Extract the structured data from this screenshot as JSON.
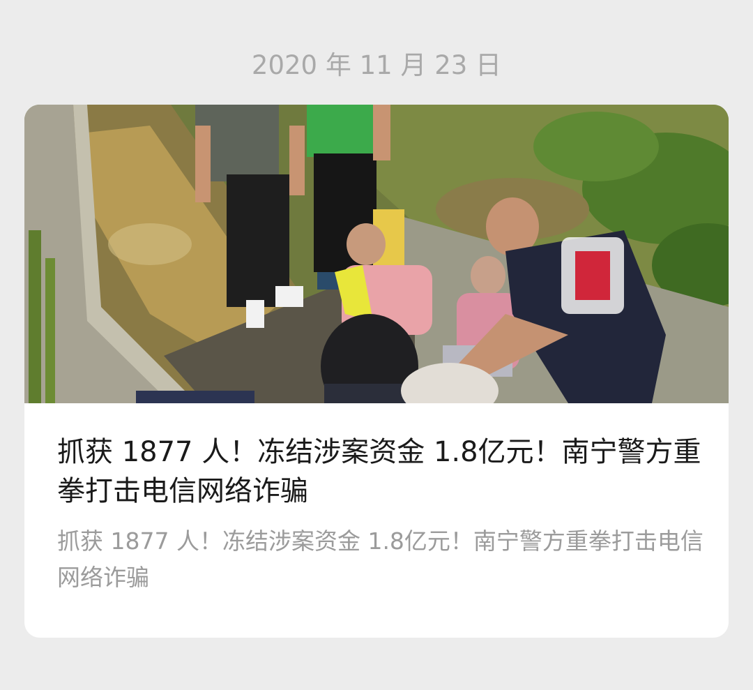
{
  "message": {
    "date": "2020 年 11 月 23 日"
  },
  "article_card": {
    "title": "抓获 1877 人！冻结涉案资金 1.8亿元！南宁警方重拳打击电信网络诈骗",
    "digest": "抓获 1877 人！冻结涉案资金 1.8亿元！南宁警方重拳打击电信网络诈骗",
    "cover_image": "police-arrest-photo"
  }
}
